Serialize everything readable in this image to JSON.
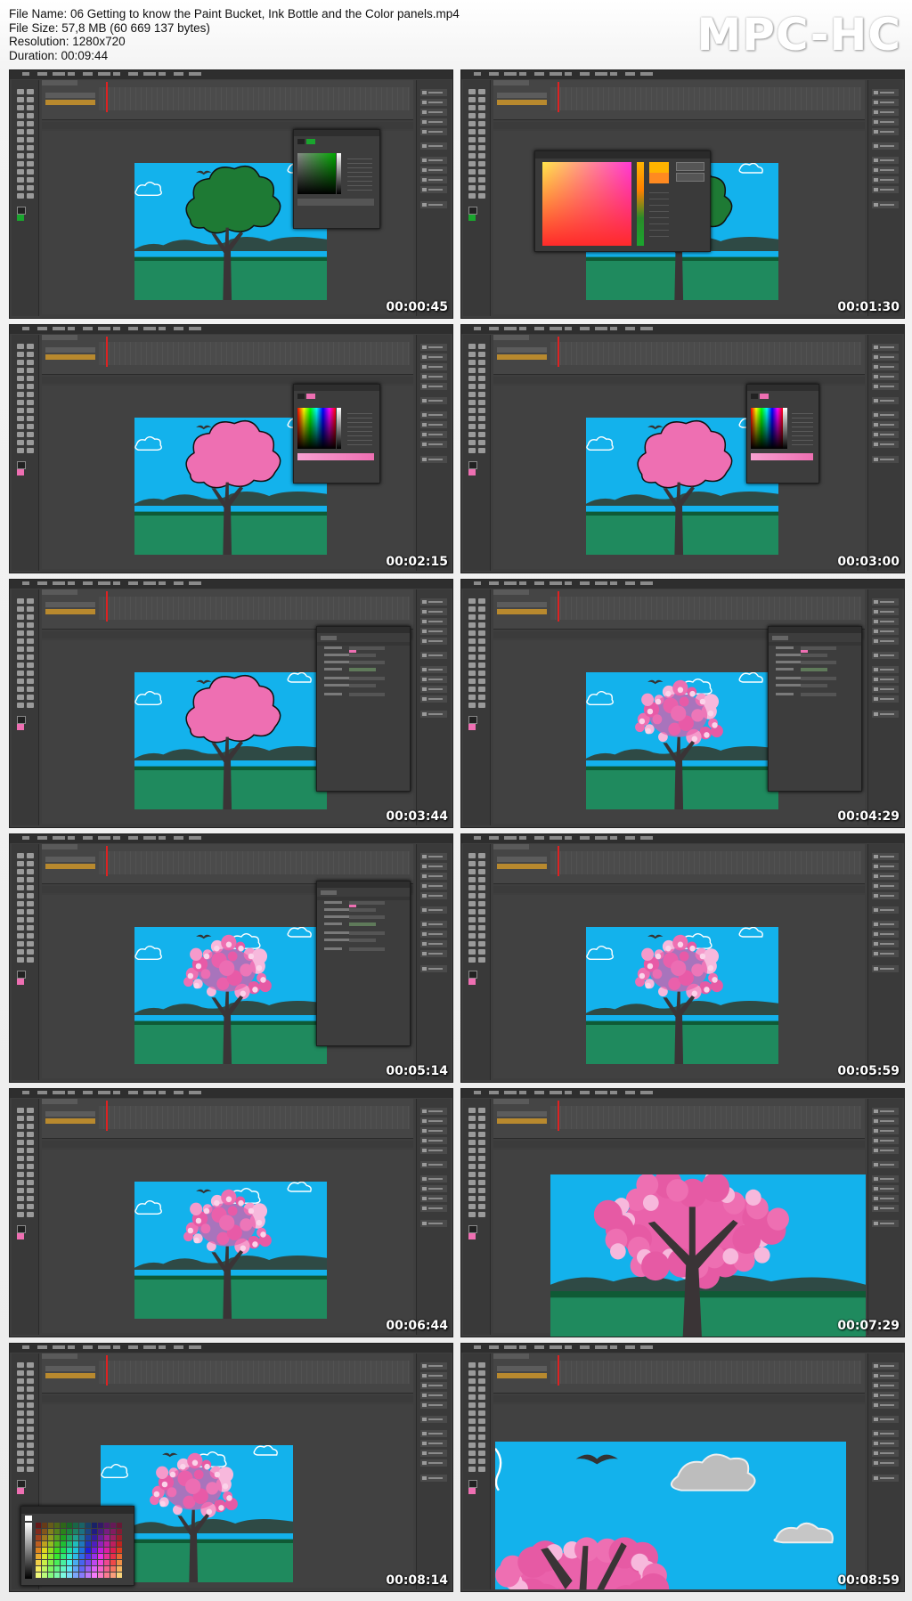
{
  "header": {
    "file_name": "File Name: 06 Getting to know the Paint Bucket, Ink Bottle and the Color panels.mp4",
    "file_size": "File Size: 57,8 MB (60 669 137 bytes)",
    "resolution": "Resolution: 1280x720",
    "duration": "Duration: 00:09:44"
  },
  "logo": "MPC-HC",
  "thumbnails": [
    {
      "timestamp": "00:00:45",
      "tree_color": "#1e7a34",
      "blossom": false,
      "panel": "color-mixer"
    },
    {
      "timestamp": "00:01:30",
      "tree_color": "#1e7a34",
      "blossom": false,
      "panel": "color-picker-dialog"
    },
    {
      "timestamp": "00:02:15",
      "tree_color": "#ee6fb2",
      "blossom": false,
      "panel": "color-mixer"
    },
    {
      "timestamp": "00:03:00",
      "tree_color": "#ee6fb2",
      "blossom": false,
      "panel": "color-mixer"
    },
    {
      "timestamp": "00:03:44",
      "tree_color": "#ee6fb2",
      "blossom": false,
      "panel": "properties"
    },
    {
      "timestamp": "00:04:29",
      "tree_color": "#ee6fb2",
      "blossom": true,
      "panel": "properties"
    },
    {
      "timestamp": "00:05:14",
      "tree_color": "#ee6fb2",
      "blossom": true,
      "panel": "properties"
    },
    {
      "timestamp": "00:05:59",
      "tree_color": "#ee6fb2",
      "blossom": true,
      "panel": "none"
    },
    {
      "timestamp": "00:06:44",
      "tree_color": "#ee6fb2",
      "blossom": true,
      "panel": "none"
    },
    {
      "timestamp": "00:07:29",
      "tree_color": "#ee6fb2",
      "blossom": true,
      "panel": "none",
      "zoom": "tree"
    },
    {
      "timestamp": "00:08:14",
      "tree_color": "#ee6fb2",
      "blossom": true,
      "panel": "swatches"
    },
    {
      "timestamp": "00:08:59",
      "tree_color": "#ee6fb2",
      "blossom": true,
      "panel": "none",
      "zoom": "sky"
    }
  ],
  "colors": {
    "sky": "#13b2ec",
    "ground": "#1f8a5e",
    "ground_dark": "#0f5a35",
    "hills": "#2f4a45",
    "green_tree": "#1e7a34",
    "pink": "#ee6fb2",
    "trunk": "#3a3436",
    "ui_bg": "#3e3e3e",
    "timeline_layer": "#b8892e"
  }
}
